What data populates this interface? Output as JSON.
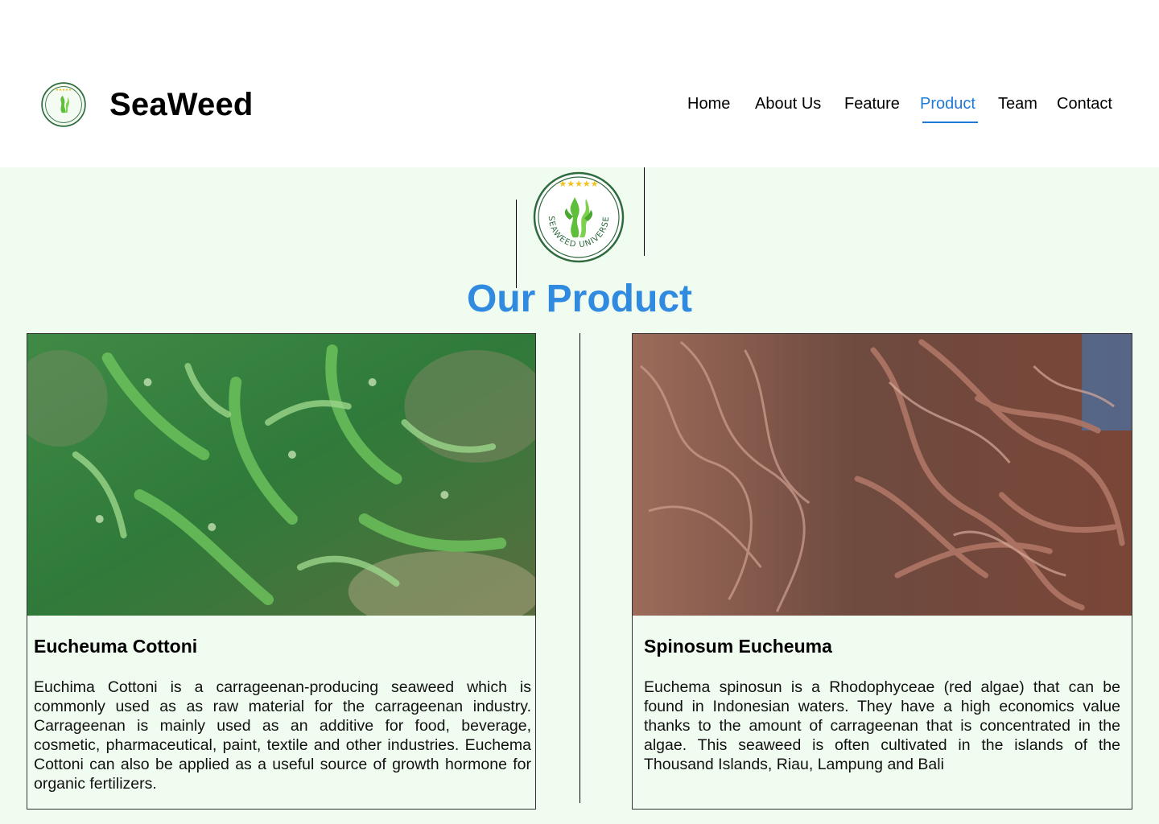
{
  "header": {
    "brand": "SeaWeed",
    "logo_icon": "seaweed-universe-logo",
    "nav": [
      {
        "label": "Home",
        "active": false
      },
      {
        "label": "About Us",
        "active": false
      },
      {
        "label": "Feature",
        "active": false
      },
      {
        "label": "Product",
        "active": true
      },
      {
        "label": "Team",
        "active": false
      },
      {
        "label": "Contact",
        "active": false
      }
    ]
  },
  "logo": {
    "text": "SEAWEED UNIVERSE",
    "stars": "★★★★★"
  },
  "section": {
    "title": "Our Product"
  },
  "products": [
    {
      "name": "Eucheuma Cottoni",
      "image": "green-seaweed-photo",
      "description": "Euchima Cottoni is a carrageenan-producing seaweed which is commonly used as as raw material for the carrageenan industry. Carrageenan is mainly used as an additive for food, beverage, cosmetic, pharmaceutical, paint, textile and other industries. Euchema Cottoni can also be applied as a useful source of growth hormone for organic fertilizers."
    },
    {
      "name": "Spinosum Eucheuma",
      "image": "red-seaweed-photo",
      "description": "Euchema spinosun is a Rhodophyceae (red algae) that can be found in Indonesian waters. They have a high economics value thanks to the amount of carrageenan that is concentrated in the algae. This seaweed is often cultivated in the islands of the Thousand Islands, Riau, Lampung and Bali"
    }
  ],
  "colors": {
    "accent": "#2f8ae0",
    "nav_active": "#1f7ad6",
    "section_bg": "#f1fcf0",
    "logo_green": "#2e6b3e",
    "seaweed_green": "#5fbf3a",
    "star_yellow": "#f2c21a"
  }
}
